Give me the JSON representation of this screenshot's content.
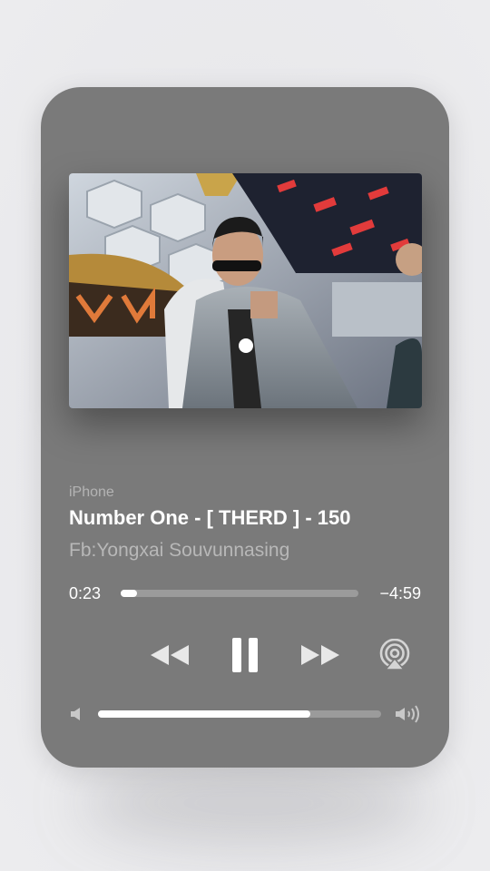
{
  "now_playing": {
    "source": "iPhone",
    "title": "Number One - [ THERD ] - 150",
    "artist": "Fb:Yongxai Souvunnasing",
    "elapsed": "0:23",
    "remaining": "−4:59",
    "progress": 0.07,
    "volume": 0.75
  },
  "icons": {
    "rewind": "rewind-icon",
    "pause": "pause-icon",
    "forward": "fast-forward-icon",
    "airplay": "airplay-icon",
    "volume_low": "speaker-low-icon",
    "volume_high": "speaker-high-icon"
  },
  "colors": {
    "card": "#7a7a7a",
    "accent": "#ffffff",
    "track": "#9b9b9b"
  }
}
